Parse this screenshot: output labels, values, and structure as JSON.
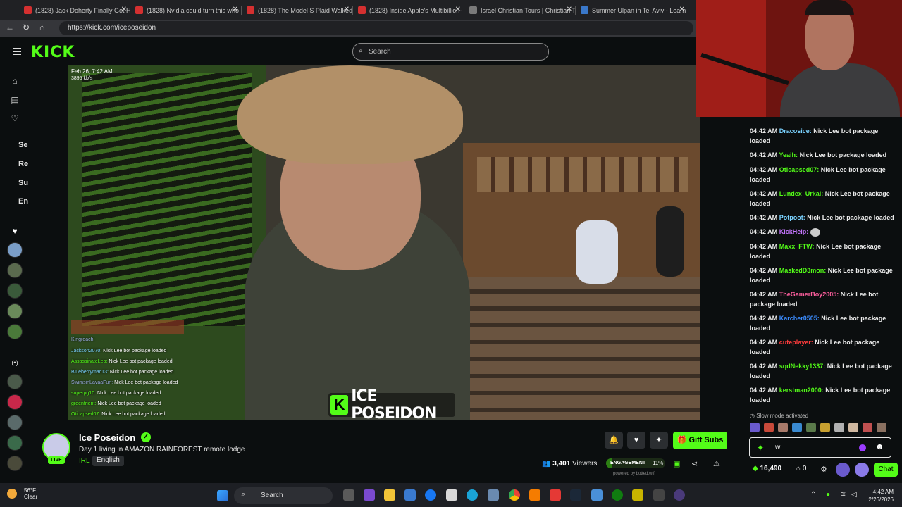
{
  "browser": {
    "tabs": [
      {
        "label": "(1828) Jack Doherty Finally Got H",
        "color": "#d43030"
      },
      {
        "label": "(1828) Nvidia could turn this who",
        "color": "#d43030"
      },
      {
        "label": "(1828) The Model S Plaid Walked",
        "color": "#d43030"
      },
      {
        "label": "(1828) Inside Apple's Multibillion-",
        "color": "#d43030"
      },
      {
        "label": "Israel Christian Tours | Christian T",
        "color": "#7a7a7a"
      },
      {
        "label": "Summer Ulpan in Tel Aviv - Learn",
        "color": "#3a78c9"
      }
    ],
    "url": "https://kick.com/iceposeidon"
  },
  "header": {
    "logo": "KICK",
    "search_placeholder": "Search"
  },
  "sidebar": {
    "labels": [
      "Se",
      "Re",
      "Su",
      "En"
    ]
  },
  "video": {
    "timestamp": "Feb 26, 7:42 AM",
    "bitrate": "3895 kb/s",
    "overlay_brand": "ICE POSEIDON",
    "overlay_chat": [
      {
        "user": "Kingroach:",
        "text": ""
      },
      {
        "user": "Jackson2070:",
        "text": "Nick Lee bot package loaded"
      },
      {
        "user": "AssassinateLeo:",
        "text": "Nick Lee bot package loaded"
      },
      {
        "user": "Blueberrymac13:",
        "text": "Nick Lee bot package loaded"
      },
      {
        "user": "SwimsinLavaaFun:",
        "text": "Nick Lee bot package loaded"
      },
      {
        "user": "superpg10:",
        "text": "Nick Lee bot package loaded"
      },
      {
        "user": "greenfrient:",
        "text": "Nick Lee bot package loaded"
      },
      {
        "user": "Oticapsed07:",
        "text": "Nick Lee bot package loaded"
      }
    ]
  },
  "stream": {
    "name": "Ice Poseidon",
    "title": "Day 1 living in AMAZON RAINFOREST remote lodge",
    "category": "IRL",
    "language": "English",
    "live_label": "LIVE",
    "viewers": "3,401",
    "viewers_label": "Viewers",
    "gift_label": "Gift Subs",
    "engagement_label": "ENGAGEMENT",
    "engagement_pct": "11%",
    "engagement_fraction": 0.11,
    "powered_by": "powered by botted.wtf"
  },
  "chat": {
    "messages": [
      {
        "time": "04:42 AM",
        "user": "Dracosice:",
        "color": "#7ad2ff",
        "text": "Nick Lee bot package loaded"
      },
      {
        "time": "04:42 AM",
        "user": "Yeaih:",
        "color": "#53fc18",
        "text": "Nick Lee bot package loaded"
      },
      {
        "time": "04:42 AM",
        "user": "Oticapsed07:",
        "color": "#53fc18",
        "text": "Nick Lee bot package loaded"
      },
      {
        "time": "04:42 AM",
        "user": "Lundex_Urkai:",
        "color": "#53fc18",
        "text": "Nick Lee bot package loaded"
      },
      {
        "time": "04:42 AM",
        "user": "Potpoot:",
        "color": "#7ad2ff",
        "text": "Nick Lee bot package loaded"
      },
      {
        "time": "04:42 AM",
        "user": "KickHelp:",
        "color": "#c576ff",
        "text": ""
      },
      {
        "time": "04:42 AM",
        "user": "Maxx_FTW:",
        "color": "#53fc18",
        "text": "Nick Lee bot package loaded"
      },
      {
        "time": "04:42 AM",
        "user": "MaskedD3mon:",
        "color": "#53fc18",
        "text": "Nick Lee bot package loaded"
      },
      {
        "time": "04:42 AM",
        "user": "TheGamerBoy2005:",
        "color": "#ff5f9e",
        "text": "Nick Lee bot package loaded"
      },
      {
        "time": "04:42 AM",
        "user": "Karcher0505:",
        "color": "#3b8cff",
        "text": "Nick Lee bot package loaded"
      },
      {
        "time": "04:42 AM",
        "user": "cuteplayer:",
        "color": "#ff3b3b",
        "text": "Nick Lee bot package loaded"
      },
      {
        "time": "04:42 AM",
        "user": "sqdNekky1337:",
        "color": "#53fc18",
        "text": "Nick Lee bot package loaded"
      },
      {
        "time": "04:42 AM",
        "user": "kerstman2000:",
        "color": "#53fc18",
        "text": "Nick Lee bot package loaded"
      }
    ],
    "slow_mode": "Slow mode activated",
    "input_value": "w",
    "coins": "16,490",
    "subs_count": "0",
    "chat_button": "Chat"
  },
  "taskbar": {
    "temp": "56°F",
    "weather": "Clear",
    "search_label": "Search",
    "time": "4:42 AM",
    "date": "2/26/2026"
  }
}
